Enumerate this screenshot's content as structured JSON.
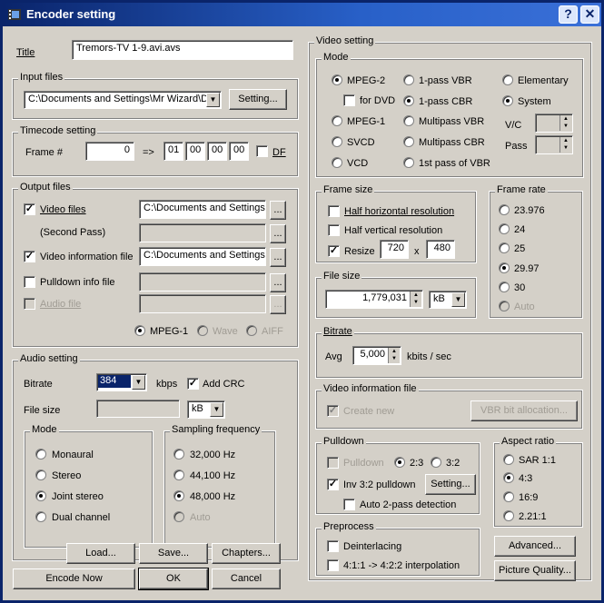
{
  "window": {
    "title": "Encoder setting"
  },
  "title_row": {
    "label": "Title",
    "value": "Tremors-TV 1-9.avi.avs"
  },
  "input": {
    "group": "Input files",
    "path": "C:\\Documents and Settings\\Mr Wizard\\D",
    "button": "Setting..."
  },
  "timecode": {
    "group": "Timecode setting",
    "frame_label": "Frame #",
    "frame_value": "0",
    "arrow": "=>",
    "hh": "01",
    "mm": "00",
    "ss": "00",
    "ff": "00",
    "df": "DF"
  },
  "output": {
    "group": "Output files",
    "video_files": "Video files",
    "video_path": "C:\\Documents and Settings\\",
    "second_pass": "(Second Pass)",
    "video_info": "Video information file",
    "info_path": "C:\\Documents and Settings\\",
    "pulldown_info": "Pulldown info file",
    "audio_file": "Audio file",
    "browse": "...",
    "fmt_mpeg1": "MPEG-1",
    "fmt_wave": "Wave",
    "fmt_aiff": "AIFF"
  },
  "audio": {
    "group": "Audio setting",
    "bitrate_label": "Bitrate",
    "bitrate_value": "384",
    "kbps": "kbps",
    "add_crc": "Add CRC",
    "filesize_label": "File size",
    "filesize_unit": "kB",
    "mode_group": "Mode",
    "modes": [
      "Monaural",
      "Stereo",
      "Joint stereo",
      "Dual channel"
    ],
    "freq_group": "Sampling frequency",
    "freqs": [
      "32,000 Hz",
      "44,100 Hz",
      "48,000 Hz",
      "Auto"
    ]
  },
  "buttons": {
    "load": "Load...",
    "save": "Save...",
    "chapters": "Chapters...",
    "encode_now": "Encode Now",
    "ok": "OK",
    "cancel": "Cancel"
  },
  "video": {
    "group": "Video setting",
    "mode_group": "Mode",
    "mpeg2": "MPEG-2",
    "for_dvd": "for DVD",
    "mpeg1": "MPEG-1",
    "svcd": "SVCD",
    "vcd": "VCD",
    "pass1_vbr": "1-pass VBR",
    "pass1_cbr": "1-pass CBR",
    "multi_vbr": "Multipass VBR",
    "multi_cbr": "Multipass CBR",
    "first_vbr": "1st pass of VBR",
    "elementary": "Elementary",
    "system": "System",
    "vc": "V/C",
    "pass": "Pass"
  },
  "frame_size": {
    "group": "Frame size",
    "half_h": "Half horizontal resolution",
    "half_v": "Half vertical resolution",
    "resize": "Resize",
    "w": "720",
    "x": "x",
    "h": "480"
  },
  "file_size": {
    "group": "File size",
    "value": "1,779,031",
    "unit": "kB"
  },
  "bitrate": {
    "group": "Bitrate",
    "avg": "Avg",
    "value": "5,000",
    "unit": "kbits / sec"
  },
  "frame_rate": {
    "group": "Frame rate",
    "rates": [
      "23.976",
      "24",
      "25",
      "29.97",
      "30",
      "Auto"
    ]
  },
  "vif": {
    "group": "Video information file",
    "create_new": "Create new",
    "vbr_button": "VBR bit allocation..."
  },
  "pulldown": {
    "group": "Pulldown",
    "pulldown": "Pulldown",
    "r23": "2:3",
    "r32": "3:2",
    "inv": "Inv 3:2 pulldown",
    "setting": "Setting...",
    "auto2": "Auto 2-pass detection"
  },
  "aspect": {
    "group": "Aspect ratio",
    "ratios": [
      "SAR 1:1",
      "4:3",
      "16:9",
      "2.21:1"
    ]
  },
  "preprocess": {
    "group": "Preprocess",
    "deinterlacing": "Deinterlacing",
    "interp": "4:1:1 -> 4:2:2 interpolation"
  },
  "side_buttons": {
    "advanced": "Advanced...",
    "picture_quality": "Picture Quality..."
  }
}
